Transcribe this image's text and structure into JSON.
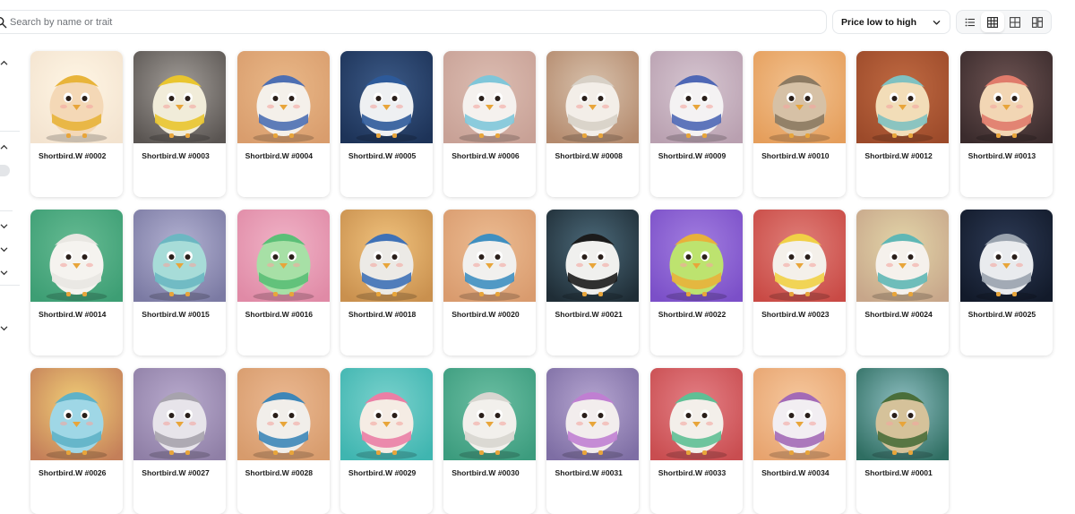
{
  "search": {
    "placeholder": "Search by name or trait",
    "value": ""
  },
  "sort": {
    "selected": "Price low to high"
  },
  "view_modes": [
    {
      "icon": "list-view-icon",
      "active": false
    },
    {
      "icon": "grid-small-view-icon",
      "active": true
    },
    {
      "icon": "grid-large-view-icon",
      "active": false
    },
    {
      "icon": "masonry-view-icon",
      "active": false
    }
  ],
  "items": [
    {
      "name": "Shortbird.W #0002",
      "bg": "#f3e3cf",
      "body": "#f4d8b6",
      "acc": "#e8b43a",
      "light": "#fff6e5"
    },
    {
      "name": "Shortbird.W #0003",
      "bg": "#5a5552",
      "body": "#f1ecd9",
      "acc": "#e9c52e",
      "light": "#a39e99"
    },
    {
      "name": "Shortbird.W #0004",
      "bg": "#d99d6d",
      "body": "#f4f0ea",
      "acc": "#4d6fb2",
      "light": "#e9b888"
    },
    {
      "name": "Shortbird.W #0005",
      "bg": "#1d3358",
      "body": "#eef0f2",
      "acc": "#2d5a9a",
      "light": "#3c5a87"
    },
    {
      "name": "Shortbird.W #0006",
      "bg": "#c8a196",
      "body": "#f5f1ee",
      "acc": "#7fc6d9",
      "light": "#dcbdb2"
    },
    {
      "name": "Shortbird.W #0008",
      "bg": "#b48a6d",
      "body": "#f3eee8",
      "acc": "#d7d0c6",
      "light": "#d8c2ad"
    },
    {
      "name": "Shortbird.W #0009",
      "bg": "#b9a0b0",
      "body": "#f4f2f3",
      "acc": "#4e67b5",
      "light": "#d6c6d1"
    },
    {
      "name": "Shortbird.W #0010",
      "bg": "#e59e5b",
      "body": "#d6c1a6",
      "acc": "#8c7a62",
      "light": "#f2c290"
    },
    {
      "name": "Shortbird.W #0012",
      "bg": "#9c4a2a",
      "body": "#f2ddb8",
      "acc": "#7fc1c1",
      "light": "#c06a42"
    },
    {
      "name": "Shortbird.W #0013",
      "bg": "#3a2b2c",
      "body": "#f2d6b4",
      "acc": "#e07b6b",
      "light": "#6e5453"
    },
    {
      "name": "Shortbird.W #0014",
      "bg": "#3d9e74",
      "body": "#f5f3ef",
      "acc": "#e9e7e2",
      "light": "#66bb93"
    },
    {
      "name": "Shortbird.W #0015",
      "bg": "#7b7aa3",
      "body": "#a7dcd8",
      "acc": "#6cb7c2",
      "light": "#b3b2d2"
    },
    {
      "name": "Shortbird.W #0016",
      "bg": "#e08aa6",
      "body": "#a7e0a6",
      "acc": "#5bbf77",
      "light": "#f0b3c7"
    },
    {
      "name": "Shortbird.W #0018",
      "bg": "#c9904e",
      "body": "#eceae6",
      "acc": "#3f71b6",
      "light": "#f0c27d"
    },
    {
      "name": "Shortbird.W #0020",
      "bg": "#d99b6e",
      "body": "#f1f0ee",
      "acc": "#3f8fc0",
      "light": "#ecbc92"
    },
    {
      "name": "Shortbird.W #0021",
      "bg": "#1f2d36",
      "body": "#f0f0ee",
      "acc": "#1b1b1b",
      "light": "#4c6a7a"
    },
    {
      "name": "Shortbird.W #0022",
      "bg": "#7b4fc8",
      "body": "#bde36f",
      "acc": "#e8b13b",
      "light": "#a27ee0"
    },
    {
      "name": "Shortbird.W #0023",
      "bg": "#c94a45",
      "body": "#f4f0ea",
      "acc": "#f1d046",
      "light": "#e0807a"
    },
    {
      "name": "Shortbird.W #0024",
      "bg": "#c7a68a",
      "body": "#f5f1ec",
      "acc": "#5fb7b5",
      "light": "#e3d6a9"
    },
    {
      "name": "Shortbird.W #0025",
      "bg": "#121a2a",
      "body": "#e9ebee",
      "acc": "#9aa3ae",
      "light": "#2d3a55"
    },
    {
      "name": "Shortbird.W #0026",
      "bg": "#c47f59",
      "body": "#9fd7e6",
      "acc": "#5fb2c7",
      "light": "#f1cf77"
    },
    {
      "name": "Shortbird.W #0027",
      "bg": "#8f7fa6",
      "body": "#e7e4ea",
      "acc": "#a7a3ad",
      "light": "#b9abce"
    },
    {
      "name": "Shortbird.W #0028",
      "bg": "#d79b6c",
      "body": "#f1eeea",
      "acc": "#3d86b8",
      "light": "#ebb992"
    },
    {
      "name": "Shortbird.W #0029",
      "bg": "#3fb5b0",
      "body": "#f5ece4",
      "acc": "#ea7fa5",
      "light": "#7bd2cd"
    },
    {
      "name": "Shortbird.W #0030",
      "bg": "#3c9c7e",
      "body": "#f2f0ec",
      "acc": "#d8d6d0",
      "light": "#6cbfa3"
    },
    {
      "name": "Shortbird.W #0031",
      "bg": "#7e6ea4",
      "body": "#f2eded",
      "acc": "#c07fd2",
      "light": "#b6a6d1"
    },
    {
      "name": "Shortbird.W #0033",
      "bg": "#c94d50",
      "body": "#f3efea",
      "acc": "#5fbf95",
      "light": "#e48086"
    },
    {
      "name": "Shortbird.W #0034",
      "bg": "#e7a36e",
      "body": "#f2eef2",
      "acc": "#a36ab6",
      "light": "#f6c99f"
    },
    {
      "name": "Shortbird.W #0001",
      "bg": "#2f6e62",
      "body": "#d5c29a",
      "acc": "#4a6e3a",
      "light": "#8fbfc2"
    }
  ]
}
